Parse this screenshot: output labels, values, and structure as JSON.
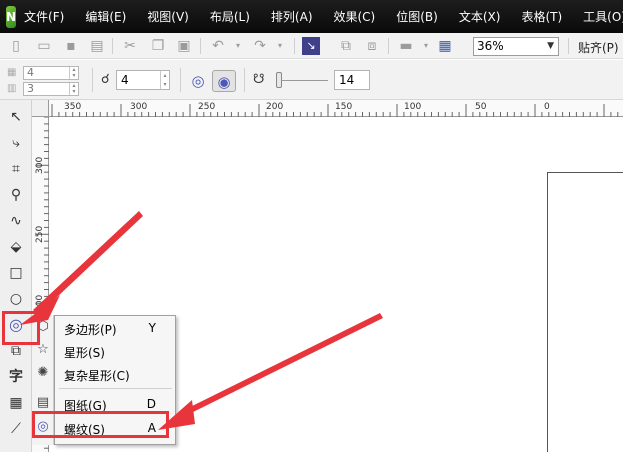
{
  "app": {
    "logo_glyph": "N"
  },
  "menubar": {
    "items": [
      "文件(F)",
      "编辑(E)",
      "视图(V)",
      "布局(L)",
      "排列(A)",
      "效果(C)",
      "位图(B)",
      "文本(X)",
      "表格(T)",
      "工具(O)"
    ]
  },
  "standard_toolbar": {
    "zoom_value": "36%",
    "snap_label": "贴齐(P)"
  },
  "property_bar": {
    "object_size_w": "4",
    "object_size_h": "3",
    "spiral_revolutions": "4",
    "expansion_value": "14"
  },
  "ruler": {
    "h_ticks": [
      "350",
      "300",
      "250",
      "200",
      "150",
      "100",
      "50",
      "0"
    ],
    "v_ticks": [
      "300",
      "250",
      "200"
    ]
  },
  "flyout": {
    "items": [
      {
        "label": "多边形(P)",
        "shortcut": "Y",
        "icon": "polygon-icon"
      },
      {
        "label": "星形(S)",
        "shortcut": "",
        "icon": "star-icon"
      },
      {
        "label": "复杂星形(C)",
        "shortcut": "",
        "icon": "complex-star-icon"
      },
      {
        "label": "图纸(G)",
        "shortcut": "D",
        "icon": "graph-paper-icon"
      },
      {
        "label": "螺纹(S)",
        "shortcut": "A",
        "icon": "spiral-icon"
      }
    ]
  },
  "toolbox": {
    "text_tool_glyph": "字"
  },
  "colors": {
    "highlight": "#e8353c",
    "menubar_bg": "#111111",
    "spiral_accent": "#4b58b6"
  }
}
